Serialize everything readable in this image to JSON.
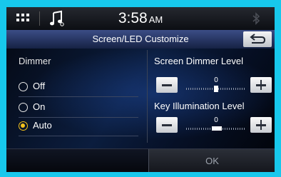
{
  "status_bar": {
    "time": "3:58",
    "ampm": "AM"
  },
  "title_bar": {
    "title": "Screen/LED Customize"
  },
  "dimmer": {
    "label": "Dimmer",
    "options": [
      {
        "label": "Off",
        "selected": false
      },
      {
        "label": "On",
        "selected": false
      },
      {
        "label": "Auto",
        "selected": true
      }
    ]
  },
  "screen_dimmer": {
    "label": "Screen Dimmer Level",
    "value": "0"
  },
  "key_illumination": {
    "label": "Key Illumination Level",
    "value": "0"
  },
  "footer": {
    "ok_label": "OK"
  },
  "colors": {
    "accent_selected": "#f4c21b",
    "frame": "#17c8ec"
  }
}
